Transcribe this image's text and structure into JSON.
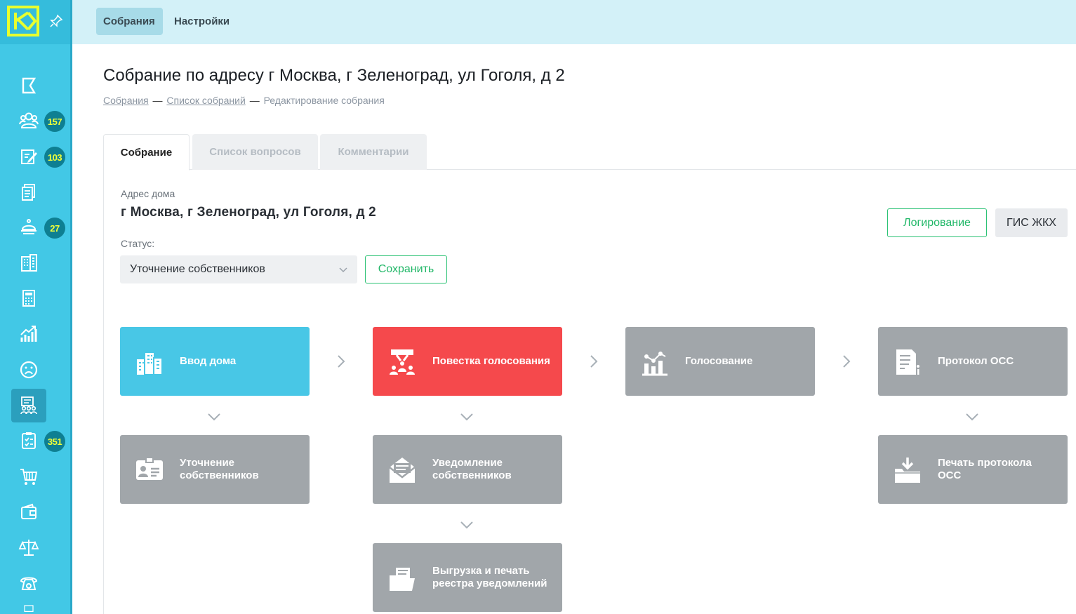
{
  "topbar": {
    "tabs": [
      {
        "label": "Собрания"
      },
      {
        "label": "Настройки"
      }
    ]
  },
  "sidebar": {
    "badges": {
      "owners": "157",
      "edit": "103",
      "service": "27",
      "tasks": "351"
    }
  },
  "page": {
    "title": "Собрание по адресу г Москва, г Зеленоград, ул Гоголя, д 2",
    "breadcrumb": {
      "item1": "Собрания",
      "item2": "Список собраний",
      "current": "Редактирование собрания",
      "separator": "—"
    }
  },
  "tabs": [
    {
      "label": "Собрание"
    },
    {
      "label": "Список вопросов"
    },
    {
      "label": "Комментарии"
    }
  ],
  "form": {
    "address_label": "Адрес дома",
    "address_value": "г Москва, г Зеленоград, ул Гоголя, д 2",
    "status_label": "Статус:",
    "status_value": "Уточнение собственников",
    "save_label": "Сохранить",
    "log_label": "Логирование",
    "gis_label": "ГИС ЖКХ"
  },
  "workflow": {
    "house_input": "Ввод дома",
    "agenda": "Повестка голосования",
    "voting": "Голосование",
    "protocol": "Протокол ОСС",
    "owners_clarify": "Уточнение собственников",
    "owners_notify": "Уведомление собственников",
    "protocol_print": "Печать протокола ОСС",
    "export_print": "Выгрузка и печать реестра уведомлений"
  },
  "colors": {
    "sidebar": "#42c8e6",
    "accent_green": "#2cc275",
    "card_blue": "#48c7e6",
    "card_red": "#f5494c",
    "card_gray": "#a1a6aa"
  }
}
